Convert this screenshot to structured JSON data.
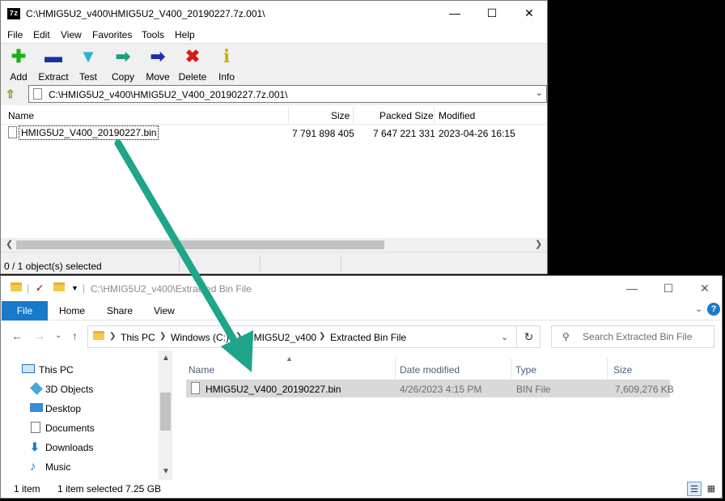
{
  "zip": {
    "app_icon": "7z",
    "title": "C:\\HMIG5U2_v400\\HMIG5U2_V400_20190227.7z.001\\",
    "menu": [
      "File",
      "Edit",
      "View",
      "Favorites",
      "Tools",
      "Help"
    ],
    "toolbar": [
      {
        "label": "Add",
        "icon": "plus-icon",
        "color": "#19b019"
      },
      {
        "label": "Extract",
        "icon": "minus-icon",
        "color": "#1a2fa8"
      },
      {
        "label": "Test",
        "icon": "check-arrow-icon",
        "color": "#28b5c8"
      },
      {
        "label": "Copy",
        "icon": "copy-arrow-icon",
        "color": "#1aa07c"
      },
      {
        "label": "Move",
        "icon": "move-arrow-icon",
        "color": "#1a2fa8"
      },
      {
        "label": "Delete",
        "icon": "x-icon",
        "color": "#d81b1b"
      },
      {
        "label": "Info",
        "icon": "info-icon",
        "color": "#d2b200"
      }
    ],
    "address": "C:\\HMIG5U2_v400\\HMIG5U2_V400_20190227.7z.001\\",
    "columns": {
      "name": "Name",
      "size": "Size",
      "packed": "Packed Size",
      "modified": "Modified"
    },
    "row": {
      "name": "HMIG5U2_V400_20190227.bin",
      "size": "7 791 898 405",
      "packed": "7 647 221 331",
      "modified": "2023-04-26 16:15"
    },
    "status": "0 / 1 object(s) selected"
  },
  "explorer": {
    "title": "C:\\HMIG5U2_v400\\Extracted Bin File",
    "tabs": {
      "file": "File",
      "home": "Home",
      "share": "Share",
      "view": "View"
    },
    "path": {
      "this_pc": "This PC",
      "drive": "Windows (C:)",
      "folder": "HMIG5U2_v400",
      "current": "Extracted Bin File"
    },
    "search_placeholder": "Search Extracted Bin File",
    "nav": [
      "This PC",
      "3D Objects",
      "Desktop",
      "Documents",
      "Downloads",
      "Music"
    ],
    "columns": {
      "name": "Name",
      "date": "Date modified",
      "type": "Type",
      "size": "Size"
    },
    "row": {
      "name": "HMIG5U2_V400_20190227.bin",
      "date": "4/26/2023 4:15 PM",
      "type": "BIN File",
      "size": "7,609,276 KB"
    },
    "status": {
      "count": "1 item",
      "selected": "1 item selected",
      "size": "7.25 GB"
    }
  },
  "colors": {
    "arrow": "#1ea58a",
    "ribbon_file": "#1979ca",
    "selected_row": "#d9d9d9"
  }
}
